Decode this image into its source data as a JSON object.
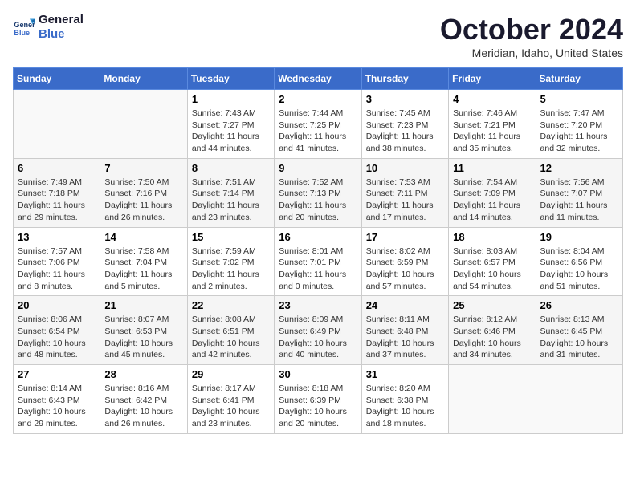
{
  "header": {
    "logo_line1": "General",
    "logo_line2": "Blue",
    "month": "October 2024",
    "location": "Meridian, Idaho, United States"
  },
  "days_of_week": [
    "Sunday",
    "Monday",
    "Tuesday",
    "Wednesday",
    "Thursday",
    "Friday",
    "Saturday"
  ],
  "weeks": [
    [
      {
        "day": "",
        "info": ""
      },
      {
        "day": "",
        "info": ""
      },
      {
        "day": "1",
        "info": "Sunrise: 7:43 AM\nSunset: 7:27 PM\nDaylight: 11 hours and 44 minutes."
      },
      {
        "day": "2",
        "info": "Sunrise: 7:44 AM\nSunset: 7:25 PM\nDaylight: 11 hours and 41 minutes."
      },
      {
        "day": "3",
        "info": "Sunrise: 7:45 AM\nSunset: 7:23 PM\nDaylight: 11 hours and 38 minutes."
      },
      {
        "day": "4",
        "info": "Sunrise: 7:46 AM\nSunset: 7:21 PM\nDaylight: 11 hours and 35 minutes."
      },
      {
        "day": "5",
        "info": "Sunrise: 7:47 AM\nSunset: 7:20 PM\nDaylight: 11 hours and 32 minutes."
      }
    ],
    [
      {
        "day": "6",
        "info": "Sunrise: 7:49 AM\nSunset: 7:18 PM\nDaylight: 11 hours and 29 minutes."
      },
      {
        "day": "7",
        "info": "Sunrise: 7:50 AM\nSunset: 7:16 PM\nDaylight: 11 hours and 26 minutes."
      },
      {
        "day": "8",
        "info": "Sunrise: 7:51 AM\nSunset: 7:14 PM\nDaylight: 11 hours and 23 minutes."
      },
      {
        "day": "9",
        "info": "Sunrise: 7:52 AM\nSunset: 7:13 PM\nDaylight: 11 hours and 20 minutes."
      },
      {
        "day": "10",
        "info": "Sunrise: 7:53 AM\nSunset: 7:11 PM\nDaylight: 11 hours and 17 minutes."
      },
      {
        "day": "11",
        "info": "Sunrise: 7:54 AM\nSunset: 7:09 PM\nDaylight: 11 hours and 14 minutes."
      },
      {
        "day": "12",
        "info": "Sunrise: 7:56 AM\nSunset: 7:07 PM\nDaylight: 11 hours and 11 minutes."
      }
    ],
    [
      {
        "day": "13",
        "info": "Sunrise: 7:57 AM\nSunset: 7:06 PM\nDaylight: 11 hours and 8 minutes."
      },
      {
        "day": "14",
        "info": "Sunrise: 7:58 AM\nSunset: 7:04 PM\nDaylight: 11 hours and 5 minutes."
      },
      {
        "day": "15",
        "info": "Sunrise: 7:59 AM\nSunset: 7:02 PM\nDaylight: 11 hours and 2 minutes."
      },
      {
        "day": "16",
        "info": "Sunrise: 8:01 AM\nSunset: 7:01 PM\nDaylight: 11 hours and 0 minutes."
      },
      {
        "day": "17",
        "info": "Sunrise: 8:02 AM\nSunset: 6:59 PM\nDaylight: 10 hours and 57 minutes."
      },
      {
        "day": "18",
        "info": "Sunrise: 8:03 AM\nSunset: 6:57 PM\nDaylight: 10 hours and 54 minutes."
      },
      {
        "day": "19",
        "info": "Sunrise: 8:04 AM\nSunset: 6:56 PM\nDaylight: 10 hours and 51 minutes."
      }
    ],
    [
      {
        "day": "20",
        "info": "Sunrise: 8:06 AM\nSunset: 6:54 PM\nDaylight: 10 hours and 48 minutes."
      },
      {
        "day": "21",
        "info": "Sunrise: 8:07 AM\nSunset: 6:53 PM\nDaylight: 10 hours and 45 minutes."
      },
      {
        "day": "22",
        "info": "Sunrise: 8:08 AM\nSunset: 6:51 PM\nDaylight: 10 hours and 42 minutes."
      },
      {
        "day": "23",
        "info": "Sunrise: 8:09 AM\nSunset: 6:49 PM\nDaylight: 10 hours and 40 minutes."
      },
      {
        "day": "24",
        "info": "Sunrise: 8:11 AM\nSunset: 6:48 PM\nDaylight: 10 hours and 37 minutes."
      },
      {
        "day": "25",
        "info": "Sunrise: 8:12 AM\nSunset: 6:46 PM\nDaylight: 10 hours and 34 minutes."
      },
      {
        "day": "26",
        "info": "Sunrise: 8:13 AM\nSunset: 6:45 PM\nDaylight: 10 hours and 31 minutes."
      }
    ],
    [
      {
        "day": "27",
        "info": "Sunrise: 8:14 AM\nSunset: 6:43 PM\nDaylight: 10 hours and 29 minutes."
      },
      {
        "day": "28",
        "info": "Sunrise: 8:16 AM\nSunset: 6:42 PM\nDaylight: 10 hours and 26 minutes."
      },
      {
        "day": "29",
        "info": "Sunrise: 8:17 AM\nSunset: 6:41 PM\nDaylight: 10 hours and 23 minutes."
      },
      {
        "day": "30",
        "info": "Sunrise: 8:18 AM\nSunset: 6:39 PM\nDaylight: 10 hours and 20 minutes."
      },
      {
        "day": "31",
        "info": "Sunrise: 8:20 AM\nSunset: 6:38 PM\nDaylight: 10 hours and 18 minutes."
      },
      {
        "day": "",
        "info": ""
      },
      {
        "day": "",
        "info": ""
      }
    ]
  ]
}
